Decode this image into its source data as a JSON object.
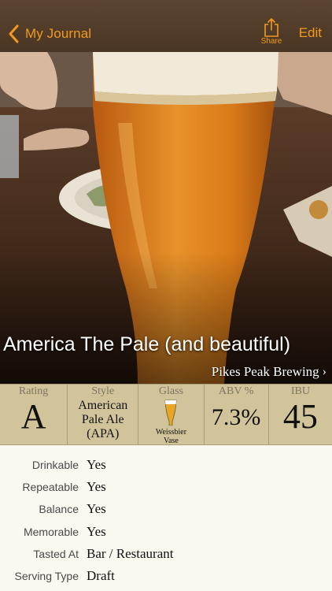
{
  "nav": {
    "back_label": "My Journal",
    "share_label": "Share",
    "edit_label": "Edit",
    "accent_color": "#f39a1e"
  },
  "beer": {
    "name": "America The Pale (and beautiful)",
    "brewery": "Pikes Peak Brewing"
  },
  "stats": {
    "rating": {
      "label": "Rating",
      "value": "A"
    },
    "style": {
      "label": "Style",
      "value_lines": [
        "American",
        "Pale Ale",
        "(APA)"
      ]
    },
    "glass": {
      "label": "Glass",
      "caption_lines": [
        "Weissbier",
        "Vase"
      ],
      "icon": "weissbier-glass-icon"
    },
    "abv": {
      "label": "ABV %",
      "value": "7.3%"
    },
    "ibu": {
      "label": "IBU",
      "value": "45"
    }
  },
  "details": {
    "rows": [
      {
        "label": "Drinkable",
        "value": "Yes"
      },
      {
        "label": "Repeatable",
        "value": "Yes"
      },
      {
        "label": "Balance",
        "value": "Yes"
      },
      {
        "label": "Memorable",
        "value": "Yes"
      },
      {
        "label": "Tasted At",
        "value": "Bar / Restaurant"
      },
      {
        "label": "Serving Type",
        "value": "Draft"
      }
    ]
  }
}
